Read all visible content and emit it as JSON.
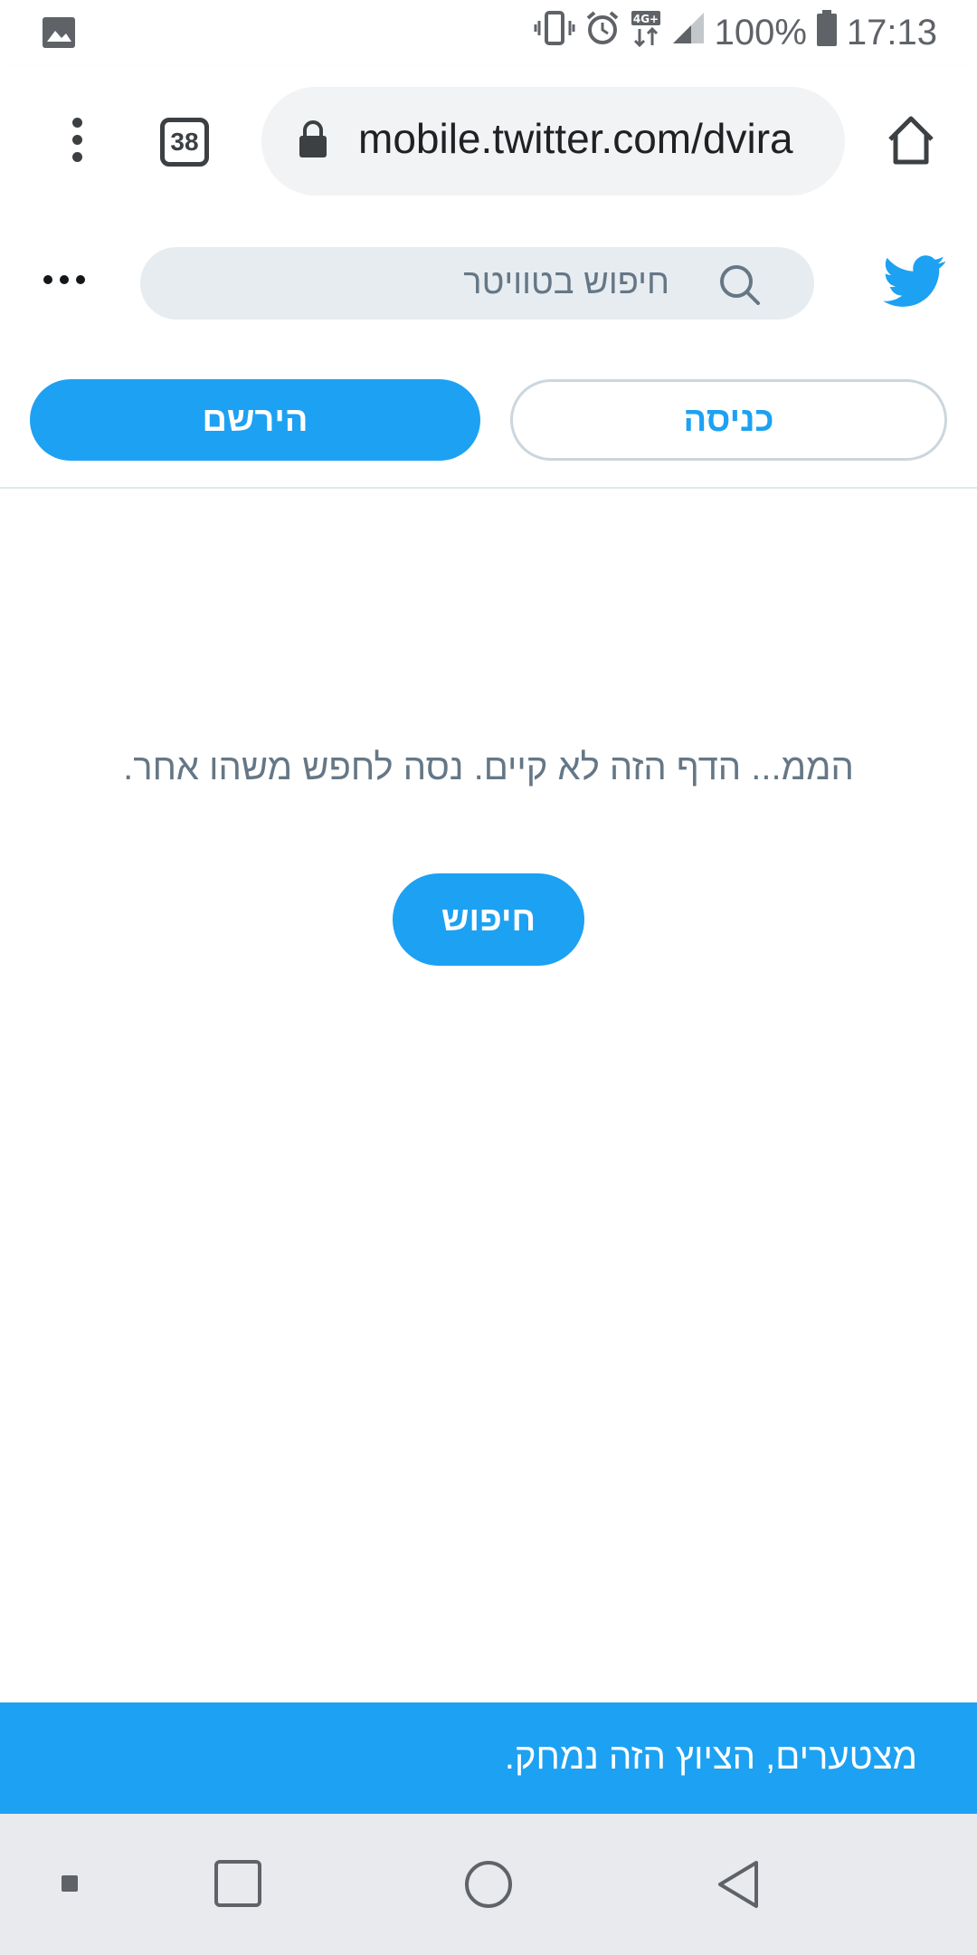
{
  "status_bar": {
    "battery": "100%",
    "time": "17:13",
    "network": "4G+"
  },
  "browser": {
    "tab_count": "38",
    "url": "mobile.twitter.com/dvira"
  },
  "twitter": {
    "search_placeholder": "חיפוש בטוויטר",
    "login_label": "כניסה",
    "signup_label": "הירשם",
    "brand_color": "#1da1f2"
  },
  "main": {
    "message": "הממ... הדף הזה לא קיים. נסה לחפש משהו אחר.",
    "search_button": "חיפוש"
  },
  "toast": {
    "message": "מצטערים, הציוץ הזה נמחק."
  },
  "icons": {
    "gallery": "image-icon",
    "vibrate": "vibrate-icon",
    "alarm": "alarm-icon",
    "signal": "signal-icon",
    "battery": "battery-icon",
    "lock": "lock-icon",
    "home": "home-icon",
    "search": "search-icon",
    "bird": "twitter-bird-icon",
    "more": "more-icon"
  }
}
